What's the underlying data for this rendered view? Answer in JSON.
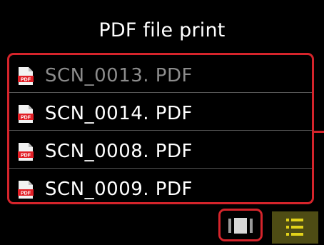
{
  "screen": {
    "title": "PDF file print"
  },
  "file_list": {
    "items": [
      {
        "name": "SCN_0013. PDF",
        "dimmed": true,
        "icon": "pdf-file-icon"
      },
      {
        "name": "SCN_0014. PDF",
        "dimmed": false,
        "icon": "pdf-file-icon"
      },
      {
        "name": "SCN_0008. PDF",
        "dimmed": false,
        "icon": "pdf-file-icon"
      },
      {
        "name": "SCN_0009. PDF",
        "dimmed": false,
        "icon": "pdf-file-icon"
      }
    ]
  },
  "bottom_bar": {
    "thumbnail_view_icon": "thumbnail-view-icon",
    "list_view_icon": "list-view-icon",
    "selected_view": "list"
  },
  "colors": {
    "background": "#000000",
    "highlight_frame": "#d5242b",
    "text": "#ffffff",
    "dim_text": "#8c8c8c",
    "list_button_bg": "#4e4c14",
    "list_icon": "#e2d21a"
  }
}
